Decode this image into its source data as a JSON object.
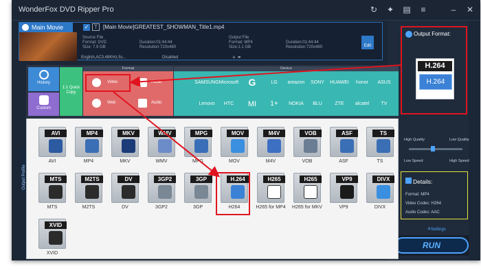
{
  "app": {
    "title": "WonderFox DVD Ripper Pro"
  },
  "source": {
    "main_movie_label": "Main Movie",
    "filename": "[Main Movie]GREATEST_SHOWMAN_Title1.mp4",
    "source_label": "Source File",
    "source_format": "Format: DVD",
    "source_size": "Size: 7.9 GB",
    "source_duration": "Duration:01:44:44",
    "source_resolution": "Resolution:720x480",
    "output_label": "Output File",
    "output_format": "Format: MP4",
    "output_size": "Size:1.1 GB",
    "output_duration": "Duration:01:44:44",
    "output_resolution": "Resolution:720x480",
    "edit_label": "Edit",
    "audio_track": "English,AC3,48KHz,5c...",
    "subtitle": "Disabled"
  },
  "output_format": {
    "title": "Output Format:",
    "badge_top": "H.264",
    "badge_bottom": "H.264"
  },
  "quality": {
    "high_quality": "High Quality",
    "low_quality": "Low Quality",
    "low_speed": "Low Speed",
    "high_speed": "High Speed"
  },
  "details": {
    "title": "Details:",
    "format": "Format: MP4",
    "video_codec": "Video Codec: H264",
    "audio_codec": "Audio Codec: AAC"
  },
  "settings_label": "Settings",
  "run_label": "RUN",
  "side_tab": "Output Profile",
  "nav": {
    "history": "History",
    "custom": "Custom",
    "quick_copy": "1:1 Quick Copy",
    "format": "Format",
    "device": "Device",
    "video": "Video",
    "audio": "Audio",
    "web": "Web",
    "audio2": "Audio"
  },
  "devices_row1": [
    "",
    "SAMSUNG",
    "Microsoft",
    "G",
    "LG",
    "amazon",
    "SONY",
    "HUAWEI",
    "honor",
    "ASUS"
  ],
  "devices_row2": [
    "",
    "Lenovo",
    "HTC",
    "MI",
    "1+",
    "NOKIA",
    "BLU",
    "ZTE",
    "alcatel",
    "TV"
  ],
  "formats": [
    {
      "label": "AVI",
      "name": "AVI",
      "color": "#2c5aa0"
    },
    {
      "label": "MP4",
      "name": "MP4",
      "color": "#3b6fb5"
    },
    {
      "label": "MKV",
      "name": "MKV",
      "color": "#1b3c78"
    },
    {
      "label": "WMV",
      "name": "WMV",
      "color": "#6b8cc8"
    },
    {
      "label": "MPG",
      "name": "MPG",
      "color": "#3a6fb8"
    },
    {
      "label": "MOV",
      "name": "MOV",
      "color": "#3a8fe0"
    },
    {
      "label": "M4V",
      "name": "M4V",
      "color": "#3d6fc2"
    },
    {
      "label": "VOB",
      "name": "VOB",
      "color": "#6b7d93"
    },
    {
      "label": "ASF",
      "name": "ASF",
      "color": "#3b6fb5"
    },
    {
      "label": "TS",
      "name": "TS",
      "color": "#3b6fb5"
    },
    {
      "label": "MTS",
      "name": "MTS",
      "color": "#2b2b2b"
    },
    {
      "label": "M2TS",
      "name": "M2TS",
      "color": "#2b2b2b"
    },
    {
      "label": "DV",
      "name": "DV",
      "color": "#2b2b2b"
    },
    {
      "label": "3GP2",
      "name": "3GP2",
      "color": "#7a8794"
    },
    {
      "label": "3GP",
      "name": "3GP",
      "color": "#7a8794"
    },
    {
      "label": "H.264",
      "name": "H264",
      "color": "#3b82d6"
    },
    {
      "label": "H265",
      "name": "H265 for MP4",
      "color": "#ffffff"
    },
    {
      "label": "H265",
      "name": "H265 for MKV",
      "color": "#ffffff"
    },
    {
      "label": "VP9",
      "name": "VP9",
      "color": "#1b1b1b"
    },
    {
      "label": "DIVX",
      "name": "DIVX",
      "color": "#3a8fe0"
    },
    {
      "label": "XVID",
      "name": "XVID",
      "color": "#2b2b2b"
    }
  ]
}
